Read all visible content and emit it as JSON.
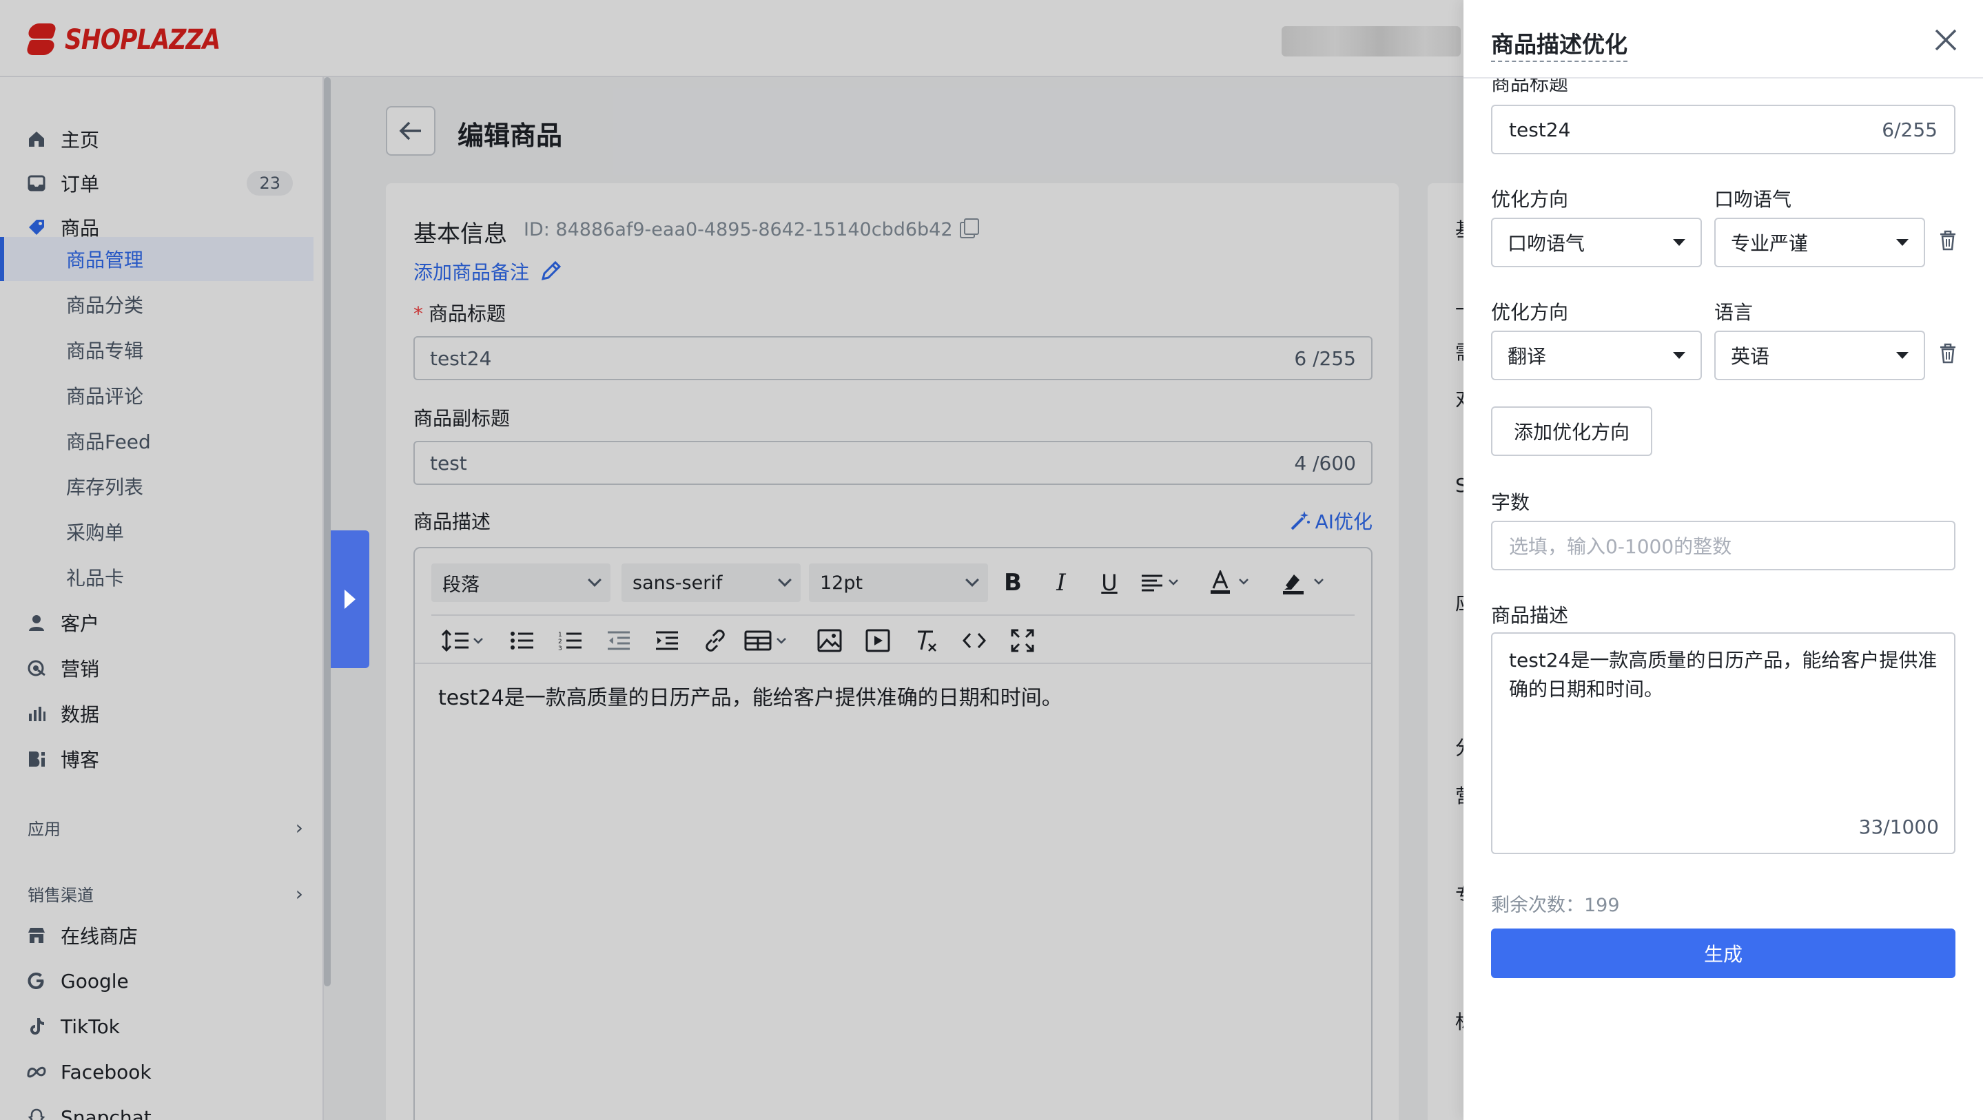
{
  "brand": {
    "name": "SHOPLAZZA",
    "color": "#e0201d"
  },
  "sidebar": {
    "items": [
      {
        "label": "主页",
        "icon": "home-icon"
      },
      {
        "label": "订单",
        "icon": "inbox-icon",
        "badge": "23"
      },
      {
        "label": "商品",
        "icon": "tag-icon"
      }
    ],
    "product_sub": [
      "商品管理",
      "商品分类",
      "商品专辑",
      "商品评论",
      "商品Feed",
      "库存列表",
      "采购单",
      "礼品卡"
    ],
    "more_items": [
      {
        "label": "客户",
        "icon": "user-icon"
      },
      {
        "label": "营销",
        "icon": "target-icon"
      },
      {
        "label": "数据",
        "icon": "bar-chart-icon"
      },
      {
        "label": "博客",
        "icon": "blog-icon"
      }
    ],
    "groups": [
      "应用",
      "销售渠道"
    ],
    "channels": [
      {
        "label": "在线商店",
        "icon": "store-icon"
      },
      {
        "label": "Google",
        "icon": "google-icon"
      },
      {
        "label": "TikTok",
        "icon": "tiktok-icon"
      },
      {
        "label": "Facebook",
        "icon": "meta-icon"
      },
      {
        "label": "Snapchat",
        "icon": "snapchat-icon"
      }
    ]
  },
  "main": {
    "page_title": "编辑商品",
    "section_title": "基本信息",
    "product_id": "ID: 84886af9-eaa0-4895-8642-15140cbd6b42",
    "add_note": "添加商品备注",
    "title_label": "商品标题",
    "title_value": "test24",
    "title_count": "6 /255",
    "subtitle_label": "商品副标题",
    "subtitle_value": "test",
    "subtitle_count": "4 /600",
    "desc_label": "商品描述",
    "ai_optimize": "AI优化",
    "editor": {
      "block_format": "段落",
      "font_family": "sans-serif",
      "font_size": "12pt",
      "content": "test24是一款高质量的日历产品，能给客户提供准确的日期和时间。"
    },
    "right_fragments": [
      "基",
      "一",
      "需",
      "对",
      "S",
      "应",
      "分",
      "营",
      "专",
      "标"
    ]
  },
  "drawer": {
    "title": "商品描述优化",
    "title_label": "商品标题",
    "title_value": "test24",
    "title_count": "6/255",
    "rows": [
      {
        "direction_label": "优化方向",
        "direction_value": "口吻语气",
        "param_label": "口吻语气",
        "param_value": "专业严谨"
      },
      {
        "direction_label": "优化方向",
        "direction_value": "翻译",
        "param_label": "语言",
        "param_value": "英语"
      }
    ],
    "add_direction": "添加优化方向",
    "word_count_label": "字数",
    "word_count_placeholder": "选填，输入0-1000的整数",
    "desc_label": "商品描述",
    "desc_value": "test24是一款高质量的日历产品，能给客户提供准确的日期和时间。",
    "desc_count": "33/1000",
    "remaining": "剩余次数：199",
    "generate": "生成",
    "accent": "#3b6ef0"
  }
}
